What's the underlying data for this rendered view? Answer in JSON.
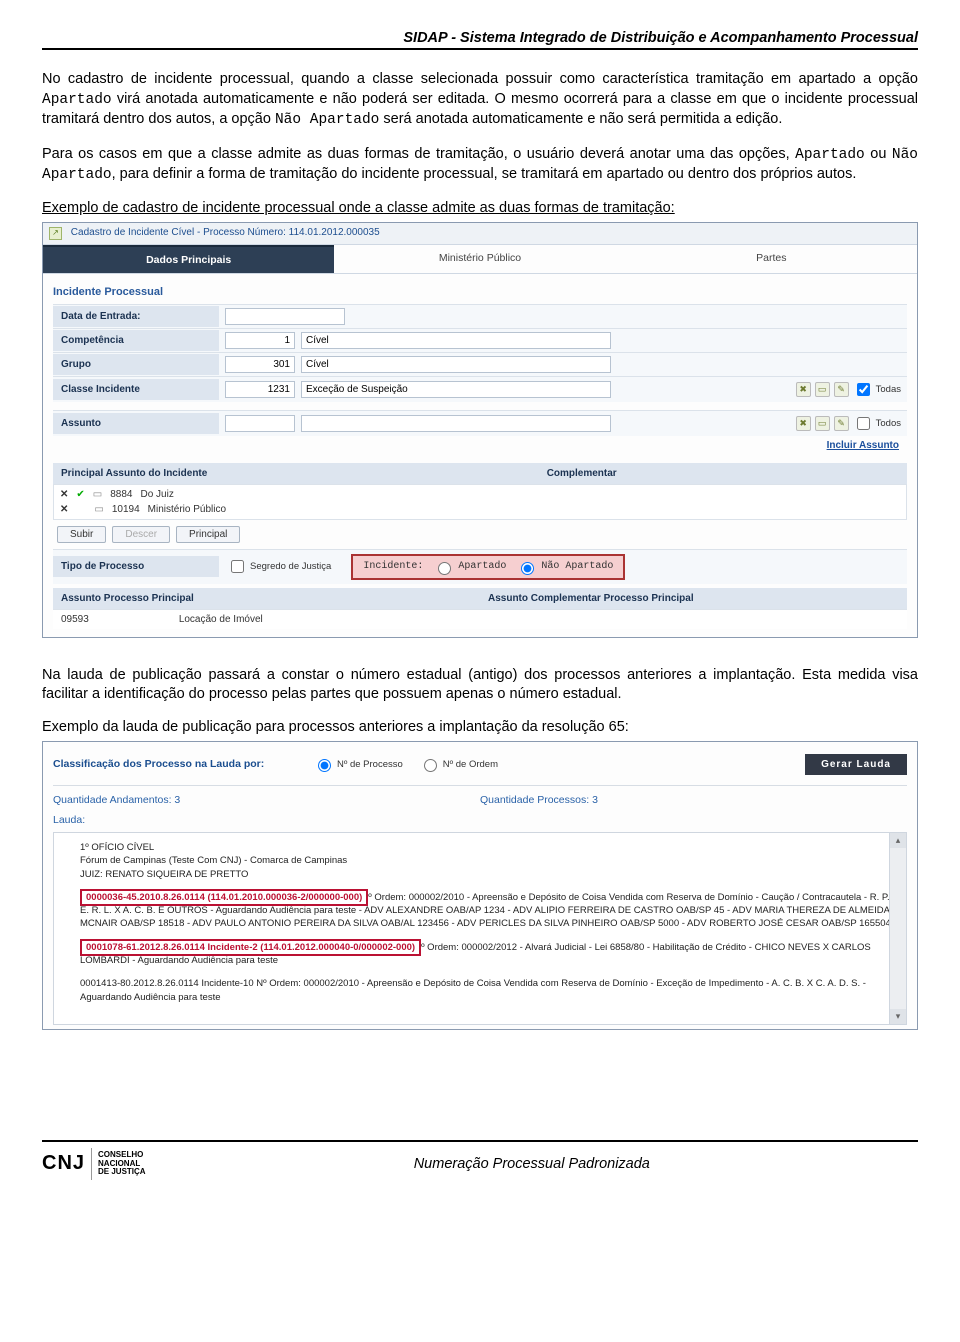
{
  "header": {
    "title": "SIDAP - Sistema Integrado de Distribuição e Acompanhamento Processual"
  },
  "paragraphs": {
    "p1a": "No cadastro de incidente processual, quando a classe selecionada possuir como característica tramitação em apartado a opção ",
    "p1_mono1": "Apartado",
    "p1b": " virá anotada automaticamente e não poderá ser editada. O mesmo ocorrerá para a classe em que o incidente processual tramitará dentro dos autos, a opção ",
    "p1_mono2": "Não Apartado",
    "p1c": " será anotada automaticamente e não será permitida a edição.",
    "p2a": "Para os casos em que a classe admite as duas formas de tramitação, o usuário deverá anotar uma das opções, ",
    "p2_mono1": "Apartado",
    "p2_or": " ou ",
    "p2_mono2": "Não Apartado",
    "p2b": ", para definir a forma de tramitação do incidente processual, se tramitará em apartado ou dentro dos próprios autos.",
    "lead1": "Exemplo de cadastro de incidente processual onde a classe admite as duas formas de tramitação:",
    "p3": "Na lauda de publicação passará a constar o número estadual (antigo) dos processos anteriores a implantação. Esta medida visa facilitar a identificação do processo pelas partes que possuem apenas o número estadual.",
    "lead2": "Exemplo da lauda de publicação para processos anteriores a implantação da resolução 65:"
  },
  "shot1": {
    "title": "Cadastro de Incidente Cível - Processo Número: 114.01.2012.000035",
    "tabs": {
      "a": "Dados Principais",
      "b": "Ministério Público",
      "c": "Partes"
    },
    "section": "Incidente Processual",
    "rows": {
      "data": {
        "label": "Data de Entrada:"
      },
      "comp": {
        "label": "Competência",
        "code": "1",
        "desc": "Cível"
      },
      "grupo": {
        "label": "Grupo",
        "code": "301",
        "desc": "Cível"
      },
      "classe": {
        "label": "Classe Incidente",
        "code": "1231",
        "desc": "Exceção de Suspeição",
        "todas": "Todas"
      },
      "assunto": {
        "label": "Assunto",
        "todos": "Todos"
      }
    },
    "incluir": "Incluir Assunto",
    "colheaders": {
      "a": "Principal Assunto do Incidente",
      "b": "Complementar"
    },
    "items": [
      {
        "code": "8884",
        "desc": "Do Juiz"
      },
      {
        "code": "10194",
        "desc": "Ministério Público"
      }
    ],
    "buttons": {
      "subir": "Subir",
      "descer": "Descer",
      "principal": "Principal"
    },
    "tipo": {
      "label": "Tipo de Processo",
      "segredo": "Segredo de Justiça",
      "inc": "Incidente:",
      "r1": "Apartado",
      "r2": "Não Apartado"
    },
    "dual": {
      "a": "Assunto Processo Principal",
      "b": "Assunto Complementar Processo Principal"
    },
    "foot": {
      "code": "09593",
      "desc": "Locação de Imóvel"
    }
  },
  "shot2": {
    "class_label": "Classificação dos Processo na Lauda por:",
    "r1": "Nº de Processo",
    "r2": "Nº de Ordem",
    "gerar": "Gerar Lauda",
    "qa": "Quantidade Andamentos: 3",
    "qp": "Quantidade Processos: 3",
    "lauda": "Lauda:",
    "doc": {
      "l1": "1º OFÍCIO CÍVEL",
      "l2": "Fórum de Campinas (Teste Com CNJ) - Comarca de Campinas",
      "l3": "JUIZ: RENATO SIQUEIRA DE PRETTO",
      "h1": "0000036-45.2010.8.26.0114 (114.01.2010.000036-2/000000-000)",
      "h1rest": "º Ordem: 000002/2010 - Apreensão e Depósito de Coisa Vendida com Reserva de Domínio - Caução / Contracautela - R. P. E. R. L. X A. C. B. E OUTROS - Aguardando Audiência para teste - ADV ALEXANDRE OAB/AP 1234 - ADV ALIPIO FERREIRA DE CASTRO OAB/SP 45 - ADV MARIA THEREZA DE ALMEIDA MCNAIR OAB/SP 18518 - ADV PAULO ANTONIO PEREIRA DA SILVA OAB/AL 123456 - ADV PERICLES DA SILVA PINHEIRO OAB/SP 5000 - ADV ROBERTO JOSÉ CESAR OAB/SP 165504",
      "h2": "0001078-61.2012.8.26.0114 Incidente-2 (114.01.2012.000040-0/000002-000)",
      "h2rest": "º Ordem: 000002/2012 - Alvará Judicial - Lei 6858/80 - Habilitação de Crédito - CHICO NEVES X CARLOS LOMBARDI - Aguardando Audiência para teste",
      "l4": "0001413-80.2012.8.26.0114 Incidente-10 Nº Ordem: 000002/2010 - Apreensão e Depósito de Coisa Vendida com Reserva de Domínio - Exceção de Impedimento - A. C. B. X C. A. D. S. - Aguardando Audiência para teste"
    }
  },
  "footer": {
    "cnj": "CNJ",
    "cnj_text": "CONSELHO\nNACIONAL\nDE JUSTIÇA",
    "title": "Numeração Processual Padronizada"
  }
}
